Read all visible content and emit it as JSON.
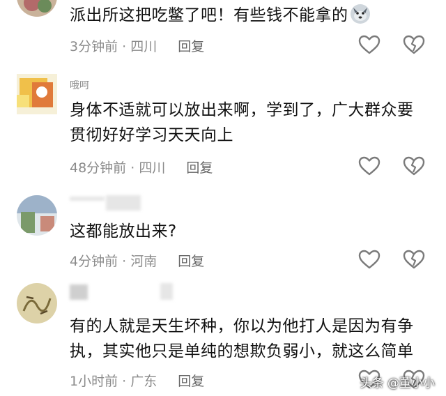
{
  "comments": [
    {
      "username": "",
      "text_lines": [
        "派出所这把吃鳖了吧！有些钱不能拿的"
      ],
      "emoji": "🐺",
      "time": "3分钟前",
      "location": "四川",
      "reply_label": "回复",
      "avatar_colors": [
        "#b36a6a",
        "#6b8b5a"
      ]
    },
    {
      "username": "哦呵",
      "text_lines": [
        "身体不适就可以放出来啊，学到了，广大群众要",
        "贯彻好好学习天天向上"
      ],
      "time": "48分钟前",
      "location": "四川",
      "reply_label": "回复",
      "avatar_colors": [
        "#f0c04a",
        "#e07a3a"
      ]
    },
    {
      "username": "",
      "text_lines": [
        "这都能放出来?"
      ],
      "time": "4分钟前",
      "location": "河南",
      "reply_label": "回复",
      "avatar_colors": [
        "#9db2c9",
        "#7b9a6a"
      ]
    },
    {
      "username": "",
      "text_lines": [
        "有的人就是天生坏种，你以为他打人是因为有争",
        "执，其实他只是单纯的想欺负弱小，就这么简单"
      ],
      "time": "1小时前",
      "location": "广东",
      "reply_label": "回复",
      "avatar_colors": [
        "#ddd2a8",
        "#7a6a3a"
      ]
    }
  ],
  "separator": "·",
  "watermark": "头条 @董小小",
  "icons": {
    "like": "heart-outline-icon",
    "dislike": "broken-heart-icon"
  },
  "colors": {
    "text": "#111111",
    "meta": "#8b8b8b",
    "icon_stroke": "#7a7a7a"
  }
}
